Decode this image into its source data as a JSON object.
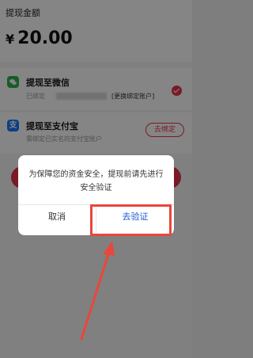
{
  "amount": {
    "title": "提现金额",
    "currency": "¥",
    "value": "20.00"
  },
  "methods": [
    {
      "title": "提现至微信",
      "bound_prefix": "已绑定",
      "change_label": "[更换绑定账户]",
      "icon": "wechat-icon",
      "selected": true
    },
    {
      "title": "提现至支付宝",
      "icon_glyph": "支",
      "subtitle": "需绑定已实名的支付宝账户",
      "action_label": "去绑定",
      "icon": "alipay-icon"
    }
  ],
  "dialog": {
    "message": "为保障您的资金安全，提现前请先进行安全验证",
    "cancel_label": "取消",
    "confirm_label": "去验证"
  },
  "colors": {
    "accent": "#e8334a",
    "link_blue": "#1f5bd0",
    "annotation_red": "#e8473d",
    "wechat_green": "#2bb24c",
    "alipay_blue": "#1677ff"
  }
}
